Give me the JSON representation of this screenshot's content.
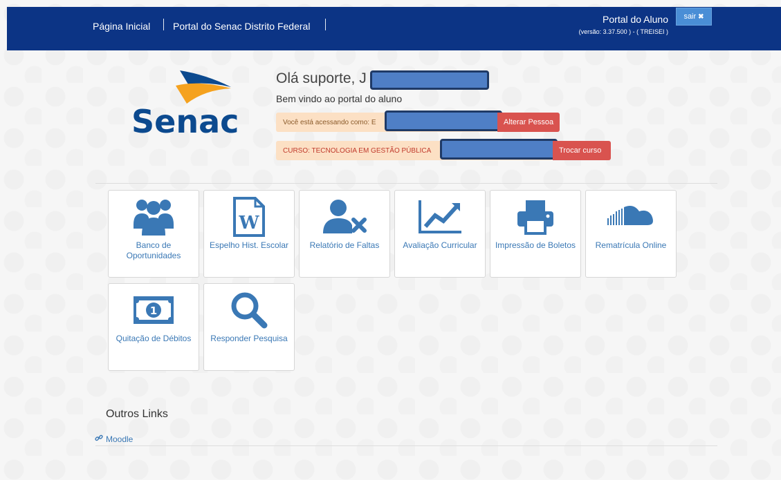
{
  "header": {
    "nav": [
      "Página Inicial",
      "Portal do Senac Distrito Federal"
    ],
    "portal_title": "Portal do Aluno",
    "version": "(versão: 3.37.500 ) - ( TREISEI )",
    "logout_label": "sair"
  },
  "logo": {
    "text": "Senac",
    "colors": {
      "blue": "#0c4a8f",
      "orange": "#f5a21f"
    }
  },
  "welcome": {
    "greeting": "Olá suporte, J",
    "subtitle": "Bem vindo ao portal do aluno",
    "acting_as": "Você está acessando como: E",
    "change_person_label": "Alterar Pessoa",
    "course": "CURSO: TECNOLOGIA EM GESTÃO PÚBLICA",
    "change_course_label": "Trocar curso"
  },
  "tiles": [
    {
      "label": "Banco de Oportunidades",
      "icon": "users-icon"
    },
    {
      "label": "Espelho Hist. Escolar",
      "icon": "word-document-icon"
    },
    {
      "label": "Relatório de Faltas",
      "icon": "user-times-icon"
    },
    {
      "label": "Avaliação Curricular",
      "icon": "line-chart-icon"
    },
    {
      "label": "Impressão de Boletos",
      "icon": "printer-icon"
    },
    {
      "label": "Rematrícula Online",
      "icon": "soundcloud-icon"
    },
    {
      "label": "Quitação de Débitos",
      "icon": "money-icon"
    },
    {
      "label": "Responder Pesquisa",
      "icon": "search-icon"
    }
  ],
  "other_links": {
    "title": "Outros Links",
    "links": [
      {
        "label": "Moodle",
        "icon": "link-icon"
      }
    ]
  },
  "colors": {
    "header": "#0c3485",
    "accent": "#3a78b5",
    "danger": "#d9534f",
    "alert_bg": "#fce0c4"
  }
}
